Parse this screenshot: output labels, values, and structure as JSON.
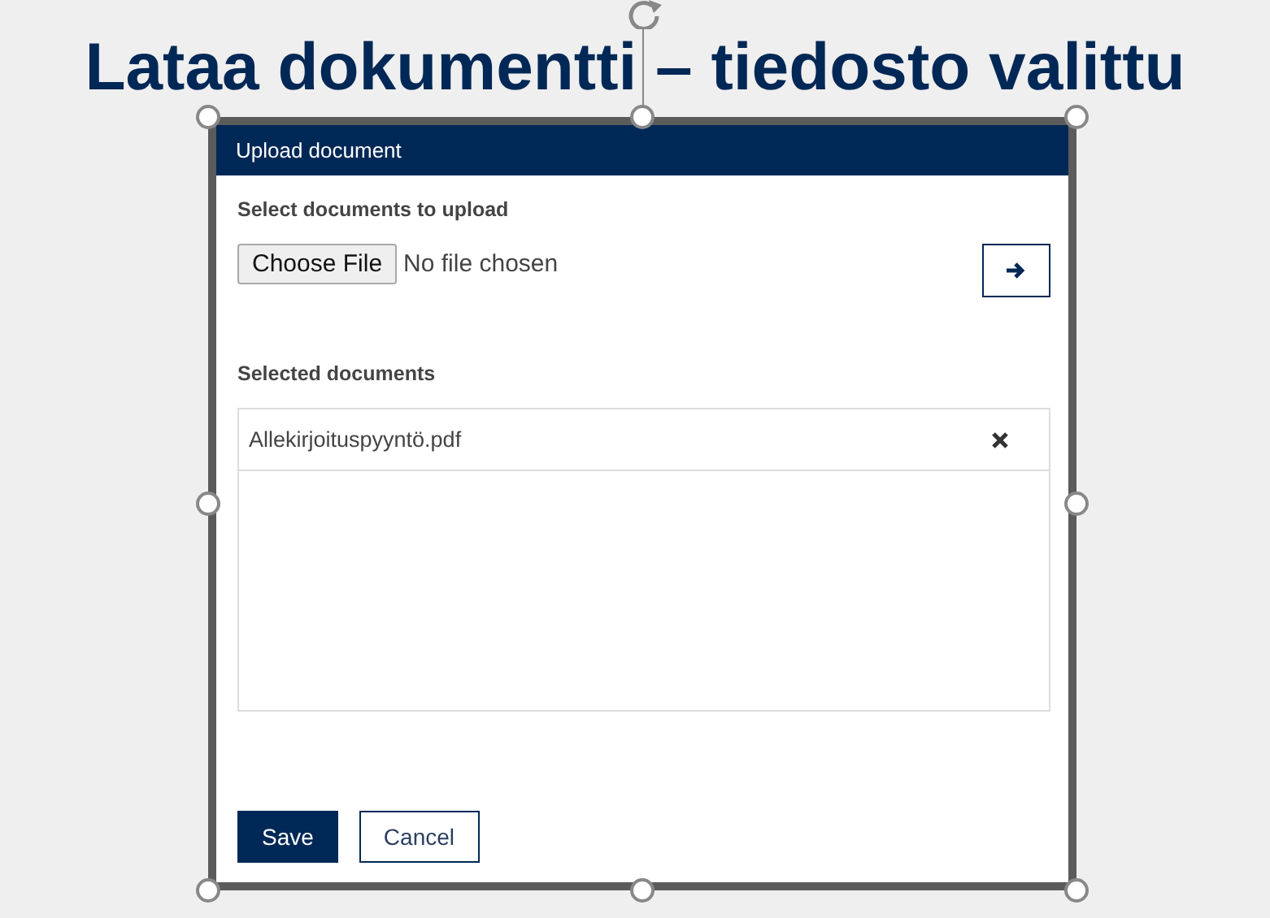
{
  "slide": {
    "title": "Lataa dokumentti – tiedosto valittu",
    "image_selected": true
  },
  "dialog": {
    "title": "Upload document",
    "upload_section": {
      "label": "Select documents to upload",
      "choose_button": "Choose File",
      "file_status": "No file chosen"
    },
    "selected_section": {
      "label": "Selected documents",
      "documents": [
        {
          "name": "Allekirjoituspyyntö.pdf"
        }
      ]
    },
    "buttons": [
      {
        "label": "Save",
        "kind": "primary"
      },
      {
        "label": "Cancel",
        "kind": "secondary"
      }
    ]
  }
}
